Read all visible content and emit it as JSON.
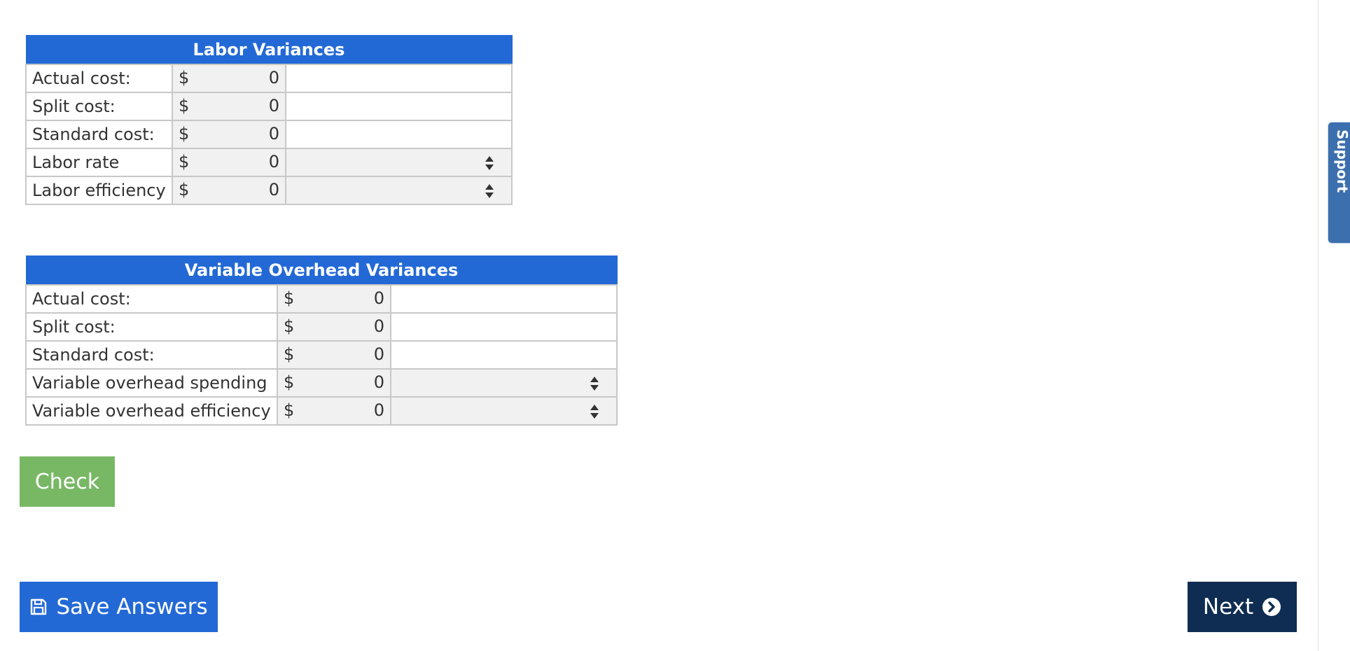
{
  "support_tab": {
    "label": "Support"
  },
  "labor": {
    "title": "Labor Variances",
    "rows": [
      {
        "label": "Actual cost:",
        "currency": "$",
        "value": "0",
        "kind": "text"
      },
      {
        "label": "Split cost:",
        "currency": "$",
        "value": "0",
        "kind": "text"
      },
      {
        "label": "Standard cost:",
        "currency": "$",
        "value": "0",
        "kind": "text"
      },
      {
        "label": "Labor rate",
        "currency": "$",
        "value": "0",
        "kind": "select"
      },
      {
        "label": "Labor efficiency",
        "currency": "$",
        "value": "0",
        "kind": "select"
      }
    ]
  },
  "overhead": {
    "title": "Variable Overhead Variances",
    "rows": [
      {
        "label": "Actual cost:",
        "currency": "$",
        "value": "0",
        "kind": "text"
      },
      {
        "label": "Split cost:",
        "currency": "$",
        "value": "0",
        "kind": "text"
      },
      {
        "label": "Standard cost:",
        "currency": "$",
        "value": "0",
        "kind": "text"
      },
      {
        "label": "Variable overhead spending",
        "currency": "$",
        "value": "0",
        "kind": "select"
      },
      {
        "label": "Variable overhead efficiency",
        "currency": "$",
        "value": "0",
        "kind": "select"
      }
    ]
  },
  "buttons": {
    "check_label": "Check",
    "save_label": "Save Answers",
    "next_label": "Next"
  },
  "icons": {
    "save": "floppy-disk-icon",
    "next": "chevron-right-circle-icon"
  },
  "colors": {
    "header_blue": "#2369d6",
    "check_green": "#78b865",
    "next_navy": "#0f2d52",
    "support_blue": "#3c6fad"
  }
}
